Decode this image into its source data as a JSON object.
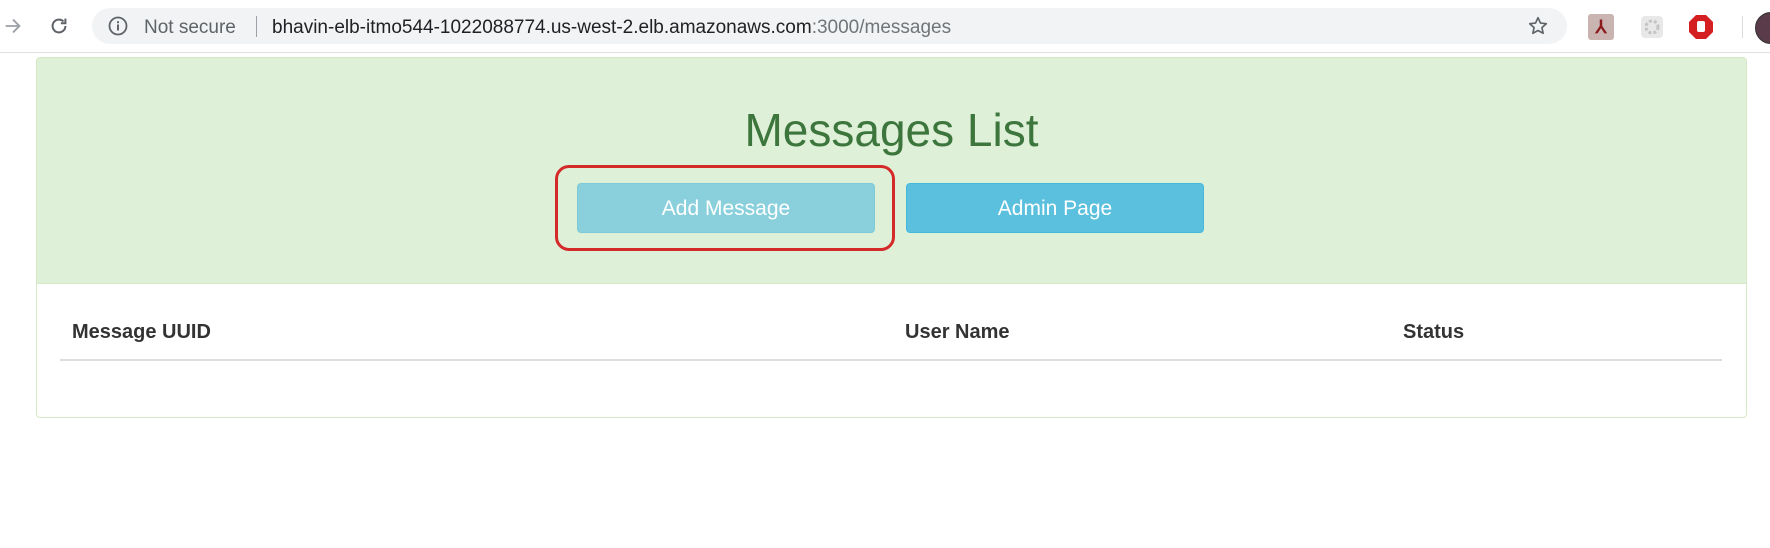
{
  "browser": {
    "security_label": "Not secure",
    "url_host": "bhavin-elb-itmo544-1022088774.us-west-2.elb.amazonaws.com",
    "url_rest": ":3000/messages"
  },
  "page": {
    "title": "Messages List",
    "buttons": {
      "add_message": "Add Message",
      "admin_page": "Admin Page"
    },
    "table": {
      "columns": [
        "Message UUID",
        "User Name",
        "Status"
      ],
      "rows": []
    }
  },
  "colors": {
    "header_bg": "#dff0d8",
    "title": "#3c763d",
    "info_button": "#5bc0de",
    "highlight": "#d42a2a"
  }
}
